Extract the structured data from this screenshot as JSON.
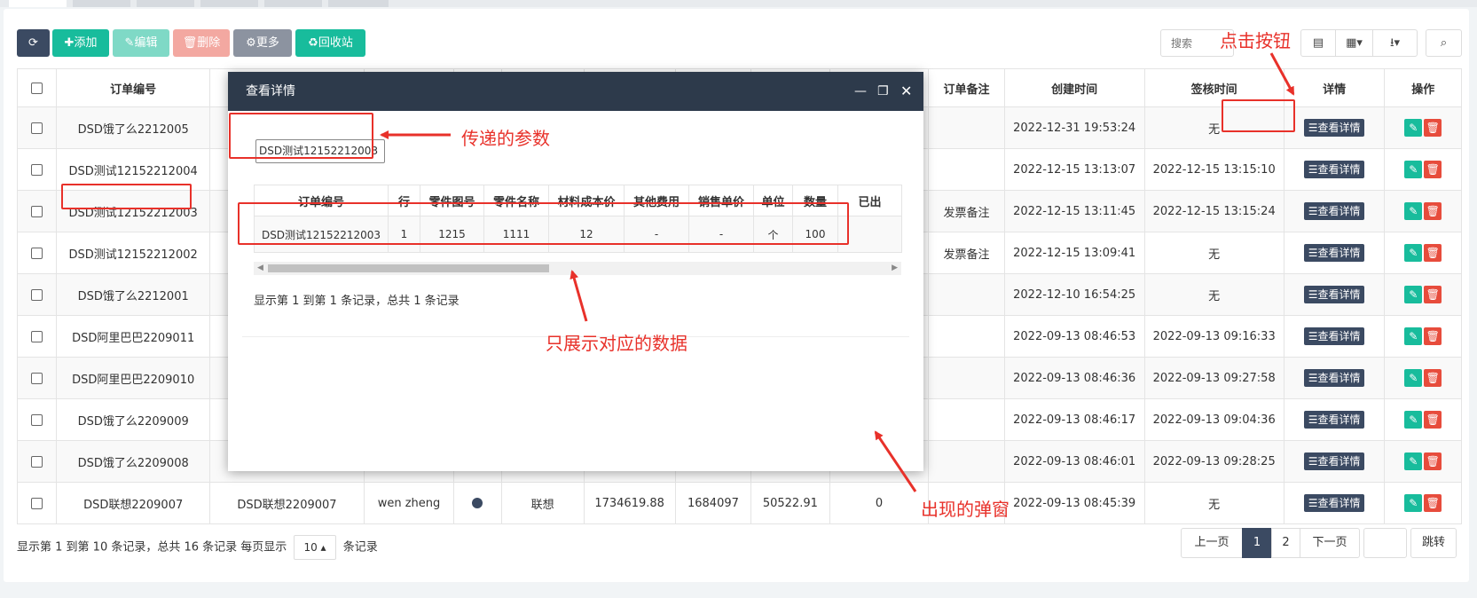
{
  "toolbar": {
    "refresh": "⟳",
    "add": "✚添加",
    "edit": "✎编辑",
    "delete": "🗑删除",
    "more": "⚙更多",
    "recycle": "♻回收站",
    "search_placeholder": "搜索"
  },
  "table": {
    "headers": {
      "order_no": "订单编号",
      "order_remark": "订单备注",
      "created_time": "创建时间",
      "signed_time": "签核时间",
      "detail": "详情",
      "operation": "操作"
    },
    "detail_button": "查看详情",
    "rows": [
      {
        "order_no": "DSD饿了么2212005",
        "remark": "",
        "created": "2022-12-31 19:53:24",
        "signed": "无"
      },
      {
        "order_no": "DSD测试12152212004",
        "remark": "",
        "created": "2022-12-15 13:13:07",
        "signed": "2022-12-15 13:15:10"
      },
      {
        "order_no": "DSD测试12152212003",
        "remark": "发票备注",
        "created": "2022-12-15 13:11:45",
        "signed": "2022-12-15 13:15:24"
      },
      {
        "order_no": "DSD测试12152212002",
        "remark": "发票备注",
        "created": "2022-12-15 13:09:41",
        "signed": "无"
      },
      {
        "order_no": "DSD饿了么2212001",
        "remark": "",
        "created": "2022-12-10 16:54:25",
        "signed": "无"
      },
      {
        "order_no": "DSD阿里巴巴2209011",
        "remark": "",
        "created": "2022-09-13 08:46:53",
        "signed": "2022-09-13 09:16:33"
      },
      {
        "order_no": "DSD阿里巴巴2209010",
        "remark": "",
        "created": "2022-09-13 08:46:36",
        "signed": "2022-09-13 09:27:58"
      },
      {
        "order_no": "DSD饿了么2209009",
        "remark": "",
        "created": "2022-09-13 08:46:17",
        "signed": "2022-09-13 09:04:36"
      },
      {
        "order_no": "DSD饿了么2209008",
        "remark": "",
        "created": "2022-09-13 08:46:01",
        "signed": "2022-09-13 09:28:25"
      },
      {
        "order_no": "DSD联想2209007",
        "remark": "",
        "created": "2022-09-13 08:45:39",
        "signed": "无"
      }
    ],
    "last_row_extra": {
      "col2": "DSD联想2209007",
      "col3": "wen zheng",
      "col5": "联想",
      "col6": "1734619.88",
      "col7": "1684097",
      "col8": "50522.91",
      "col9": "0"
    }
  },
  "footer": {
    "info_prefix": "显示第 1 到第 10 条记录，总共 16 条记录 每页显示",
    "page_size": "10 ▴",
    "info_suffix": "条记录",
    "prev": "上一页",
    "page1": "1",
    "page2": "2",
    "next": "下一页",
    "jump": "跳转"
  },
  "modal": {
    "title": "查看详情",
    "param_value": "DSD测试12152212003",
    "headers": [
      "订单编号",
      "行",
      "零件图号",
      "零件名称",
      "材料成本价",
      "其他费用",
      "销售单价",
      "单位",
      "数量",
      "已出"
    ],
    "row": [
      "DSD测试12152212003",
      "1",
      "1215",
      "1111",
      "12",
      "-",
      "-",
      "个",
      "100",
      ""
    ],
    "info": "显示第 1 到第 1 条记录，总共 1 条记录"
  },
  "annotations": {
    "param": "传递的参数",
    "click": "点击按钮",
    "data": "只展示对应的数据",
    "popup": "出现的弹窗",
    "color": "#e8312a"
  }
}
